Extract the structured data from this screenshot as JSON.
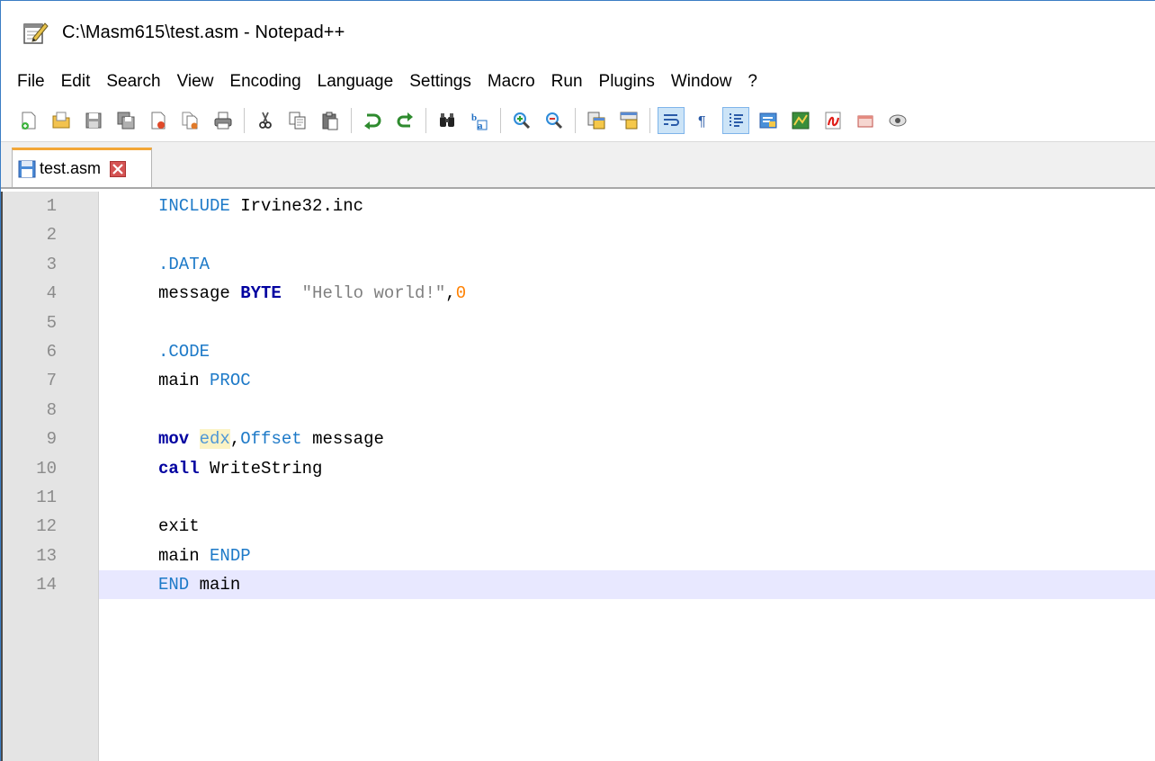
{
  "window": {
    "title": "C:\\Masm615\\test.asm - Notepad++"
  },
  "menu": [
    "File",
    "Edit",
    "Search",
    "View",
    "Encoding",
    "Language",
    "Settings",
    "Macro",
    "Run",
    "Plugins",
    "Window",
    "?"
  ],
  "toolbar": {
    "icons": [
      "new-file-icon",
      "open-file-icon",
      "save-icon",
      "save-all-icon",
      "close-icon",
      "close-all-icon",
      "print-icon",
      "cut-icon",
      "copy-icon",
      "paste-icon",
      "undo-icon",
      "redo-icon",
      "find-icon",
      "replace-icon",
      "zoom-in-icon",
      "zoom-out-icon",
      "sync-vertical-icon",
      "sync-horizontal-icon",
      "word-wrap-icon",
      "show-all-chars-icon",
      "indent-guide-icon",
      "function-list-icon",
      "document-map-icon",
      "monitoring-icon",
      "folder-icon"
    ]
  },
  "tab": {
    "label": "test.asm"
  },
  "editor": {
    "current_line": 14,
    "lines": [
      {
        "num": "1",
        "tokens": [
          {
            "t": "INCLUDE",
            "c": "kw-blue"
          },
          {
            "t": " Irvine32.inc",
            "c": ""
          }
        ]
      },
      {
        "num": "2",
        "tokens": []
      },
      {
        "num": "3",
        "tokens": [
          {
            "t": ".DATA",
            "c": "kw-blue"
          }
        ]
      },
      {
        "num": "4",
        "tokens": [
          {
            "t": "message ",
            "c": ""
          },
          {
            "t": "BYTE",
            "c": "kw-bold"
          },
          {
            "t": "  ",
            "c": ""
          },
          {
            "t": "\"Hello world!\"",
            "c": "str"
          },
          {
            "t": ",",
            "c": ""
          },
          {
            "t": "0",
            "c": "num"
          }
        ]
      },
      {
        "num": "5",
        "tokens": []
      },
      {
        "num": "6",
        "tokens": [
          {
            "t": ".CODE",
            "c": "kw-blue"
          }
        ]
      },
      {
        "num": "7",
        "tokens": [
          {
            "t": "main ",
            "c": ""
          },
          {
            "t": "PROC",
            "c": "kw-blue"
          }
        ]
      },
      {
        "num": "8",
        "tokens": []
      },
      {
        "num": "9",
        "tokens": [
          {
            "t": "mov",
            "c": "kw-bold"
          },
          {
            "t": " ",
            "c": ""
          },
          {
            "t": "edx",
            "c": "reg"
          },
          {
            "t": ",",
            "c": ""
          },
          {
            "t": "Offset",
            "c": "kw-blue"
          },
          {
            "t": " message",
            "c": ""
          }
        ]
      },
      {
        "num": "10",
        "tokens": [
          {
            "t": "call",
            "c": "kw-bold"
          },
          {
            "t": " WriteString",
            "c": ""
          }
        ]
      },
      {
        "num": "11",
        "tokens": []
      },
      {
        "num": "12",
        "tokens": [
          {
            "t": "exit",
            "c": ""
          }
        ]
      },
      {
        "num": "13",
        "tokens": [
          {
            "t": "main ",
            "c": ""
          },
          {
            "t": "ENDP",
            "c": "kw-blue"
          }
        ]
      },
      {
        "num": "14",
        "tokens": [
          {
            "t": "END",
            "c": "kw-blue"
          },
          {
            "t": " main",
            "c": ""
          }
        ]
      }
    ]
  }
}
